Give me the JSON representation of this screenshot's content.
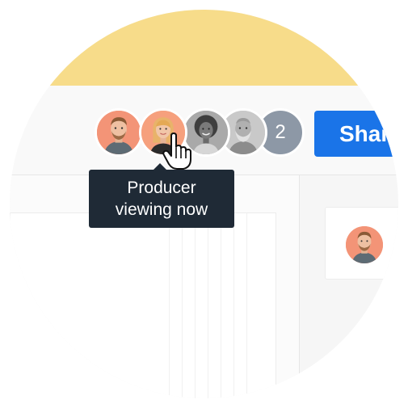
{
  "colors": {
    "top_bar": "#f7dc8a",
    "share_button": "#1a74e8",
    "tooltip_bg": "#1f2a36",
    "overflow_badge": "#8d98a6"
  },
  "collaborators": {
    "avatars": [
      {
        "icon": "man-with-beard-avatar-icon"
      },
      {
        "icon": "woman-blonde-avatar-icon"
      },
      {
        "icon": "woman-curly-hair-avatar-icon"
      },
      {
        "icon": "older-man-beard-avatar-icon"
      }
    ],
    "overflow_count": "2"
  },
  "toolbar": {
    "share_label": "Share"
  },
  "tooltip": {
    "line1": "Producer",
    "line2": "viewing now"
  },
  "cursor": {
    "icon": "pointer-hand-cursor-icon"
  },
  "comment_card": {
    "avatar_icon": "man-with-beard-avatar-icon"
  }
}
